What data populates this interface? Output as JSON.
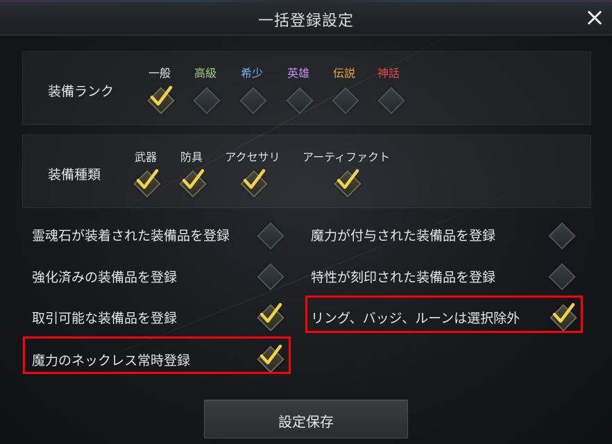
{
  "window": {
    "title": "一括登録設定"
  },
  "equipment_rank": {
    "label": "装備ランク",
    "items": [
      {
        "label": "一般",
        "color": "#e6e6e6",
        "checked": true
      },
      {
        "label": "高級",
        "color": "#a7d27a",
        "checked": false
      },
      {
        "label": "希少",
        "color": "#6cb6e6",
        "checked": false
      },
      {
        "label": "英雄",
        "color": "#c88cf0",
        "checked": false
      },
      {
        "label": "伝説",
        "color": "#f0a63c",
        "checked": false
      },
      {
        "label": "神話",
        "color": "#e84848",
        "checked": false
      }
    ]
  },
  "equipment_type": {
    "label": "装備種類",
    "items": [
      {
        "label": "武器",
        "checked": true
      },
      {
        "label": "防具",
        "checked": true
      },
      {
        "label": "アクセサリ",
        "checked": true
      },
      {
        "label": "アーティファクト",
        "checked": true
      }
    ]
  },
  "options": {
    "left": [
      {
        "label": "霊魂石が装着された装備品を登録",
        "checked": false
      },
      {
        "label": "強化済みの装備品を登録",
        "checked": false
      },
      {
        "label": "取引可能な装備品を登録",
        "checked": true
      },
      {
        "label": "魔力のネックレス常時登録",
        "checked": true
      }
    ],
    "right": [
      {
        "label": "魔力が付与された装備品を登録",
        "checked": false
      },
      {
        "label": "特性が刻印された装備品を登録",
        "checked": false
      },
      {
        "label": "リング、バッジ、ルーンは選択除外",
        "checked": true
      }
    ]
  },
  "save_button": {
    "label": "設定保存"
  },
  "colors": {
    "highlight": "#ff0000",
    "check": "#f2d24a"
  }
}
